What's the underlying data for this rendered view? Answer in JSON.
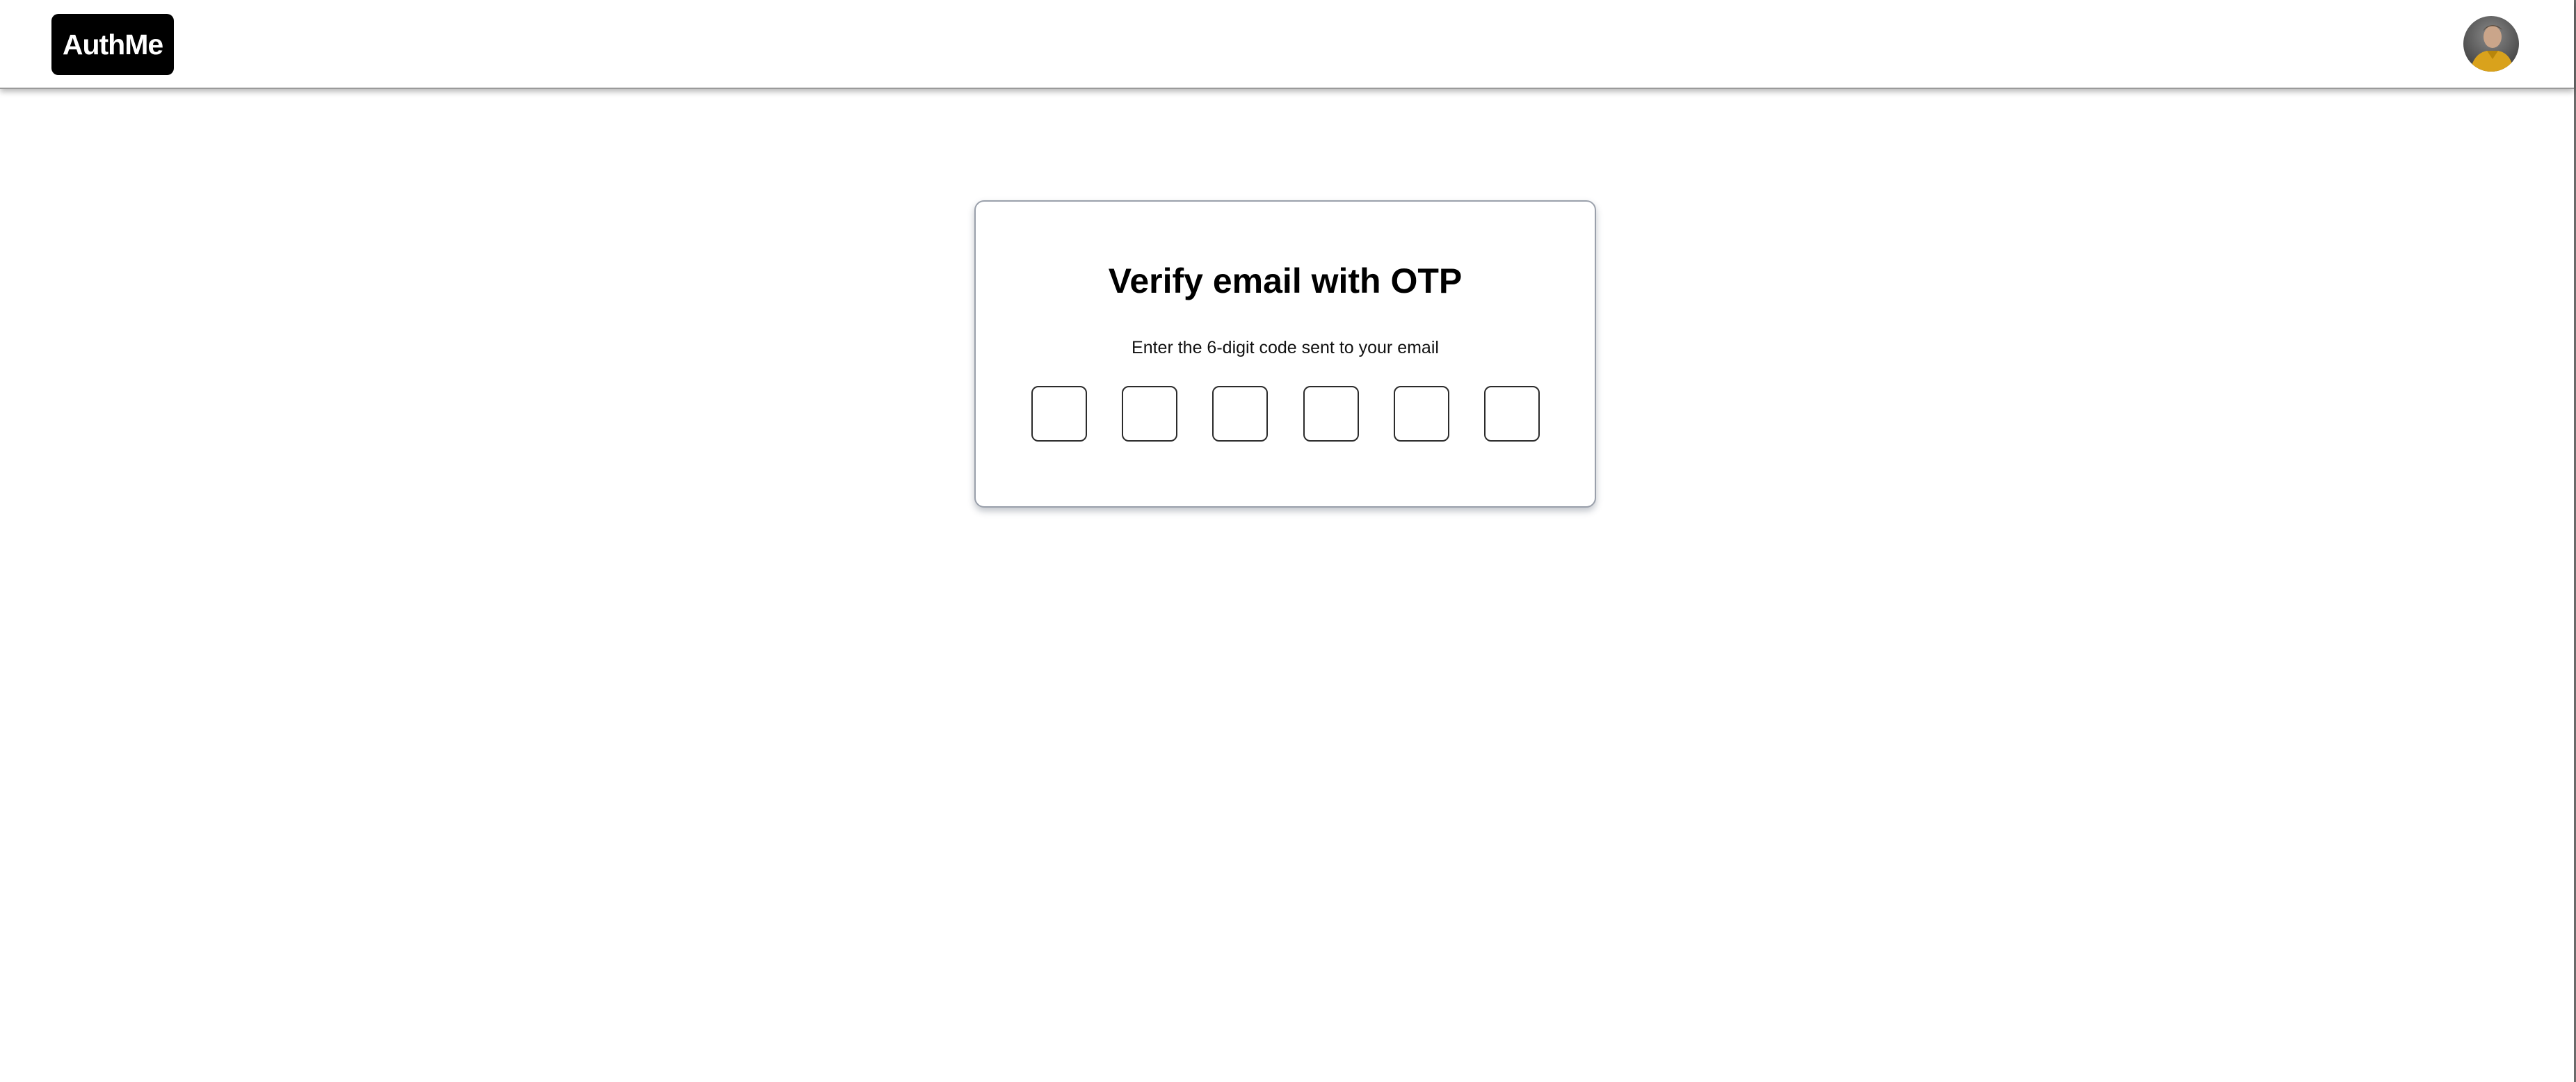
{
  "header": {
    "logo_text": "AuthMe",
    "avatar_label": "user avatar",
    "avatar_icon": "avatar-icon"
  },
  "verify_card": {
    "title": "Verify email with OTP",
    "subtitle": "Enter the 6-digit code sent to your email",
    "otp_fields": [
      {
        "value": ""
      },
      {
        "value": ""
      },
      {
        "value": ""
      },
      {
        "value": ""
      },
      {
        "value": ""
      },
      {
        "value": ""
      }
    ]
  },
  "colors": {
    "logo_background": "#000000",
    "logo_text": "#ffffff",
    "card_border": "#9aa0ab",
    "otp_border": "#2b2b2b",
    "page_background": "#ffffff"
  }
}
